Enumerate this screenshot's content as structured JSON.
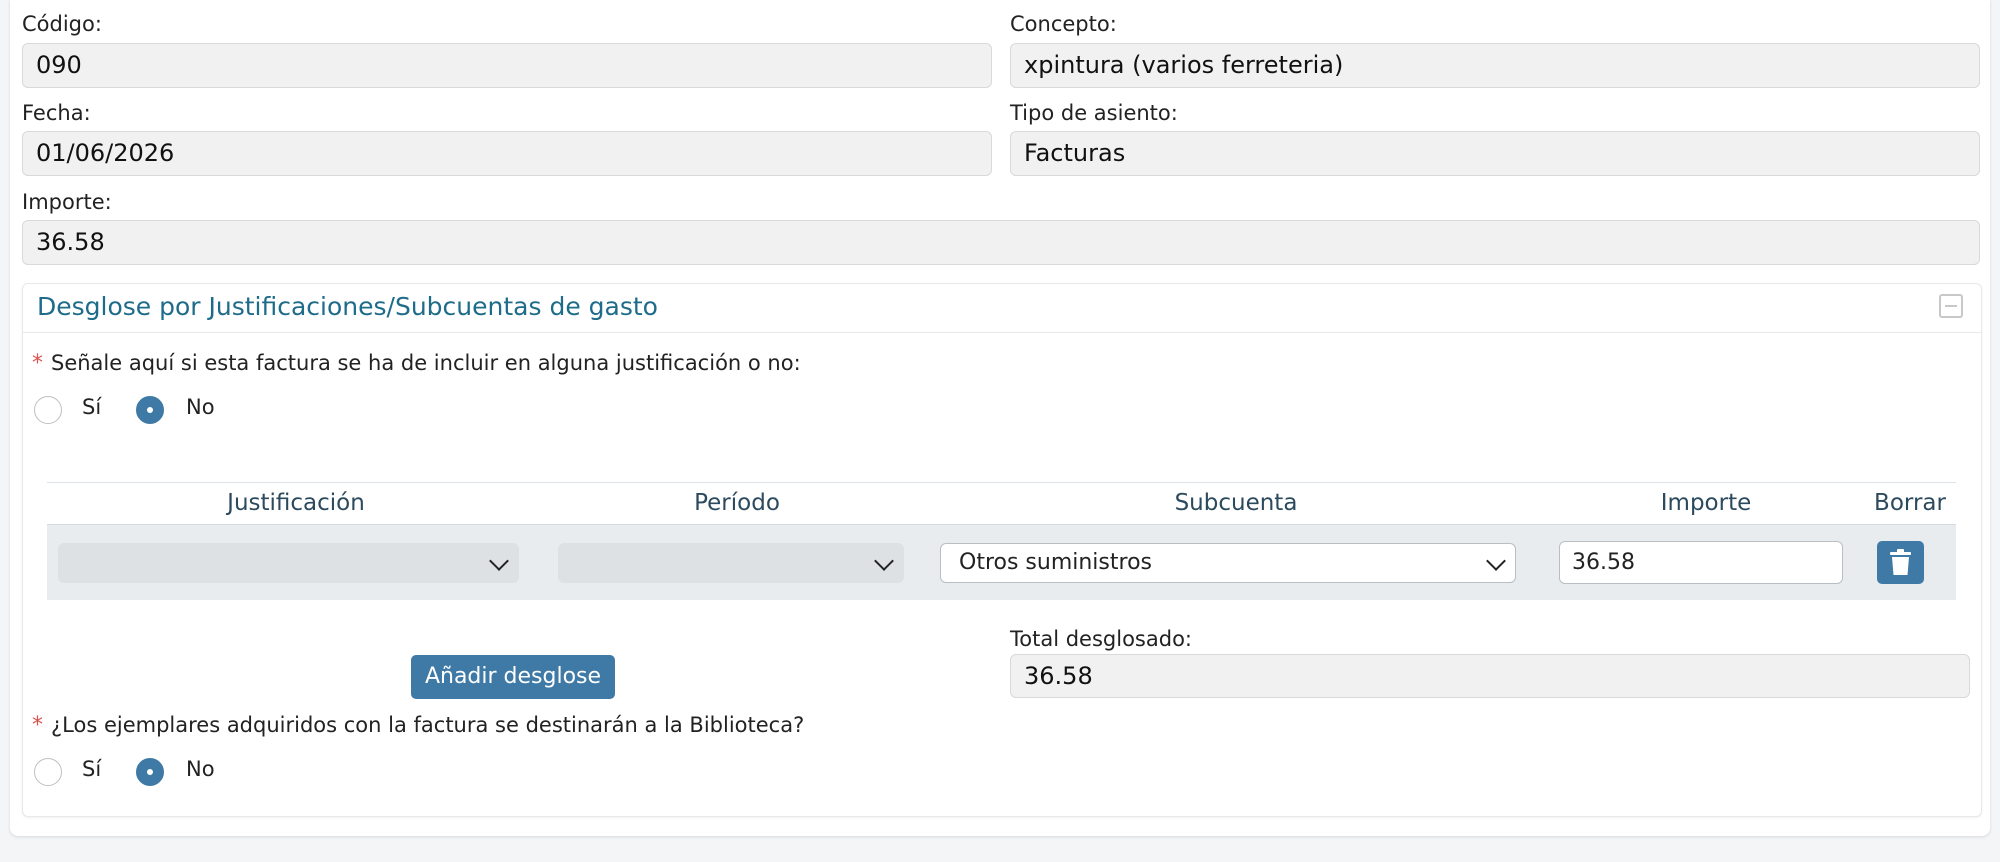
{
  "header": {
    "codigo_label": "Código:",
    "codigo_value": "090",
    "concepto_label": "Concepto:",
    "concepto_value": "xpintura (varios ferreteria)",
    "fecha_label": "Fecha:",
    "fecha_value": "01/06/2026",
    "tipo_label": "Tipo de asiento:",
    "tipo_value": "Facturas",
    "importe_label": "Importe:",
    "importe_value": "36.58"
  },
  "desglose": {
    "title": "Desglose por Justificaciones/Subcuentas de gasto",
    "required_mark": "*",
    "question1": "Señale aquí si esta factura se ha de incluir en alguna justificación o no:",
    "q1_options": [
      "Sí",
      "No"
    ],
    "q1_selected": "No",
    "table": {
      "headers": [
        "Justificación",
        "Período",
        "Subcuenta",
        "Importe",
        "Borrar"
      ],
      "rows": [
        {
          "justificacion": "",
          "periodo": "",
          "subcuenta": "Otros suministros",
          "importe": "36.58"
        }
      ]
    },
    "add_button": "Añadir desglose",
    "total_label": "Total desglosado:",
    "total_value": "36.58",
    "question2": "¿Los ejemplares adquiridos con la factura se destinarán a la Biblioteca?",
    "q2_options": [
      "Sí",
      "No"
    ],
    "q2_selected": "No"
  },
  "colors": {
    "accent": "#3e7aa5",
    "title": "#1e6c8a",
    "required": "#d9534f"
  }
}
